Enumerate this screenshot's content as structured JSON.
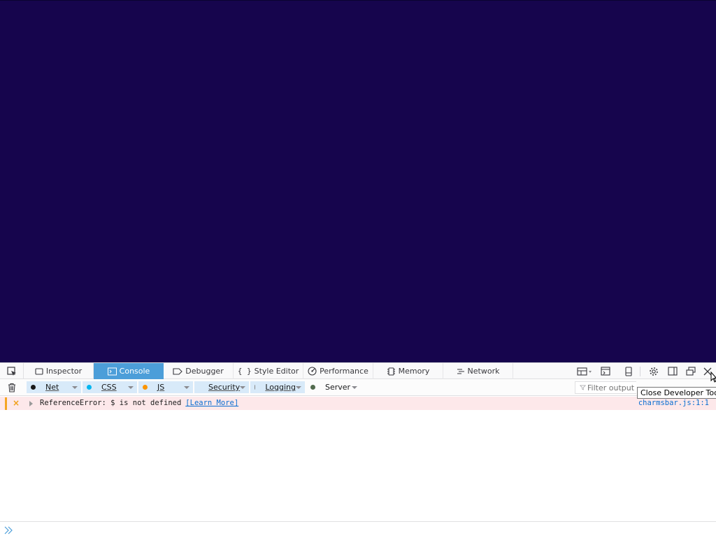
{
  "devtools": {
    "tabs": [
      {
        "label": "Inspector",
        "icon": "inspector-icon"
      },
      {
        "label": "Console",
        "icon": "console-icon",
        "selected": true
      },
      {
        "label": "Debugger",
        "icon": "debugger-icon"
      },
      {
        "label": "Style Editor",
        "icon": "style-editor-icon"
      },
      {
        "label": "Performance",
        "icon": "performance-icon"
      },
      {
        "label": "Memory",
        "icon": "memory-icon"
      },
      {
        "label": "Network",
        "icon": "network-icon"
      }
    ],
    "toolbar_right": [
      "frames-icon",
      "split-console-icon",
      "responsive-design-icon",
      "settings-icon",
      "dock-side-icon",
      "undock-icon",
      "close-icon"
    ]
  },
  "filters": {
    "categories": [
      {
        "label": "Net",
        "color": "#18191a",
        "active": true
      },
      {
        "label": "CSS",
        "color": "#00b6f0",
        "active": true
      },
      {
        "label": "JS",
        "color": "#fb9500",
        "active": true
      },
      {
        "label": "Security",
        "color": "#ec1e0d",
        "active": true
      },
      {
        "label": "Logging",
        "color": "#868686",
        "active": true
      },
      {
        "label": "Server",
        "color": "#526b4e",
        "active": false
      }
    ],
    "filter_placeholder": "Filter output"
  },
  "console": {
    "messages": [
      {
        "level": "error",
        "text": "ReferenceError: $ is not defined",
        "link": "[Learn More]",
        "source": "charmsbar.js:1:1"
      }
    ]
  },
  "tooltip": "Close Developer Tools",
  "colors": {
    "page_background": "#16054d",
    "selected_tab": "#4c9ed9",
    "error_row": "#fde8ea"
  }
}
